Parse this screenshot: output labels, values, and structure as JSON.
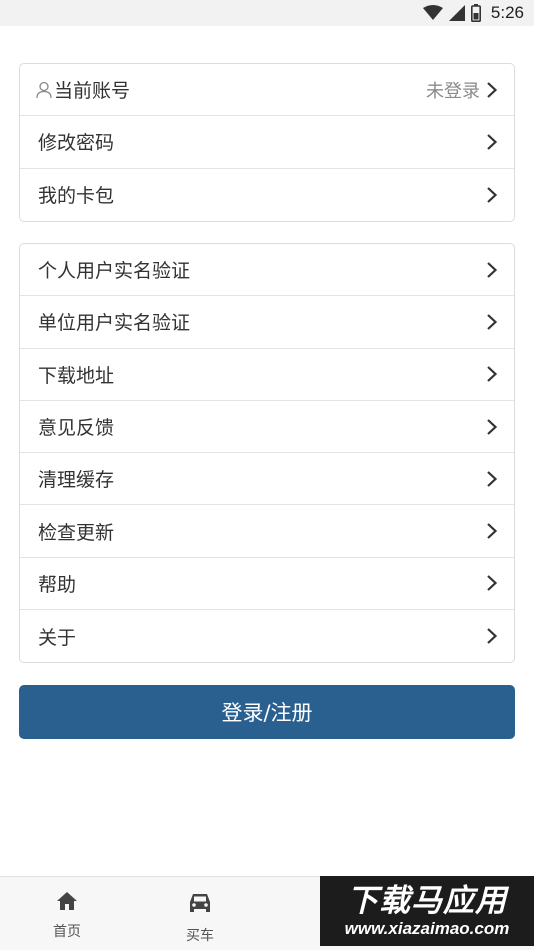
{
  "status_bar": {
    "time": "5:26",
    "icons": [
      "wifi-icon",
      "signal-icon",
      "battery-icon"
    ]
  },
  "account_group": {
    "items": [
      {
        "label": "当前账号",
        "value": "未登录",
        "icon": "user-icon"
      },
      {
        "label": "修改密码"
      },
      {
        "label": "我的卡包"
      }
    ]
  },
  "settings_group": {
    "items": [
      {
        "label": "个人用户实名验证"
      },
      {
        "label": "单位用户实名验证"
      },
      {
        "label": "下载地址"
      },
      {
        "label": "意见反馈"
      },
      {
        "label": "清理缓存"
      },
      {
        "label": "检查更新"
      },
      {
        "label": "帮助"
      },
      {
        "label": "关于"
      }
    ]
  },
  "login_button": {
    "label": "登录/注册"
  },
  "bottom_nav": {
    "items": [
      {
        "label": "首页",
        "icon": "home-icon"
      },
      {
        "label": "买车",
        "icon": "car-icon"
      }
    ]
  },
  "watermark": {
    "title": "下载马应用",
    "url": "www.xiazaimao.com"
  },
  "colors": {
    "primary_button": "#2a6090",
    "border": "#dcdcdc",
    "muted_text": "#8a8a8a"
  }
}
